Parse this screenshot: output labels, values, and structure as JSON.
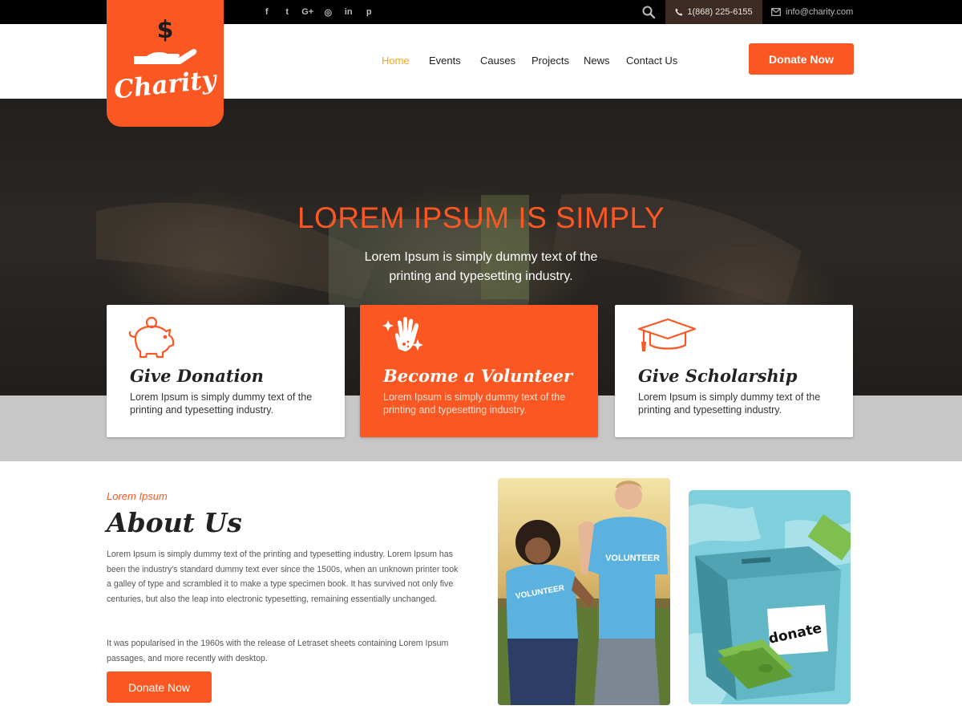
{
  "topbar": {
    "social_icons": [
      "facebook-icon",
      "twitter-icon",
      "google-plus-icon",
      "instagram-icon",
      "linkedin-icon",
      "pinterest-icon"
    ],
    "social_glyphs": [
      "f",
      "t",
      "G+",
      "◎",
      "in",
      "p"
    ],
    "phone": "1(868) 225-6155",
    "email": "info@charity.com"
  },
  "logo": {
    "text": "Charity"
  },
  "nav": {
    "items": [
      {
        "label": "Home",
        "active": true
      },
      {
        "label": "Events"
      },
      {
        "label": "Causes"
      },
      {
        "label": "Projects"
      },
      {
        "label": "News"
      },
      {
        "label": "Contact Us"
      }
    ],
    "donate_label": "Donate Now"
  },
  "hero": {
    "title": "LOREM IPSUM IS SIMPLY",
    "subtitle": "Lorem Ipsum is simply dummy text of the printing and typesetting industry."
  },
  "cards": [
    {
      "title": "Give Donation",
      "text": "Lorem Ipsum is simply dummy text of the printing and typesetting industry.",
      "icon": "piggy-bank-icon"
    },
    {
      "title": "Become a Volunteer",
      "text": "Lorem Ipsum is simply dummy text of the printing and typesetting industry.",
      "icon": "raised-hand-icon"
    },
    {
      "title": "Give Scholarship",
      "text": "Lorem Ipsum is simply dummy text of the printing and typesetting industry.",
      "icon": "graduation-cap-icon"
    }
  ],
  "about": {
    "kicker": "Lorem Ipsum",
    "title": "About Us",
    "paragraph1": "Lorem Ipsum is simply dummy text of the printing and typesetting industry. Lorem Ipsum has been the industry's standard dummy text ever since the 1500s, when an unknown printer took a galley of type and scrambled it to make a type specimen book. It has survived not only five centuries, but also the leap into electronic typesetting, remaining essentially unchanged.",
    "paragraph2": "It was popularised in the 1960s with the release of Letraset sheets containing Lorem Ipsum passages, and more recently with desktop.",
    "donate_label": "Donate Now",
    "shirt_text": "VOLUNTEER",
    "box_label": "donate"
  },
  "colors": {
    "accent": "#fa5722",
    "active_nav": "#f5a623",
    "topbar": "#000000"
  }
}
